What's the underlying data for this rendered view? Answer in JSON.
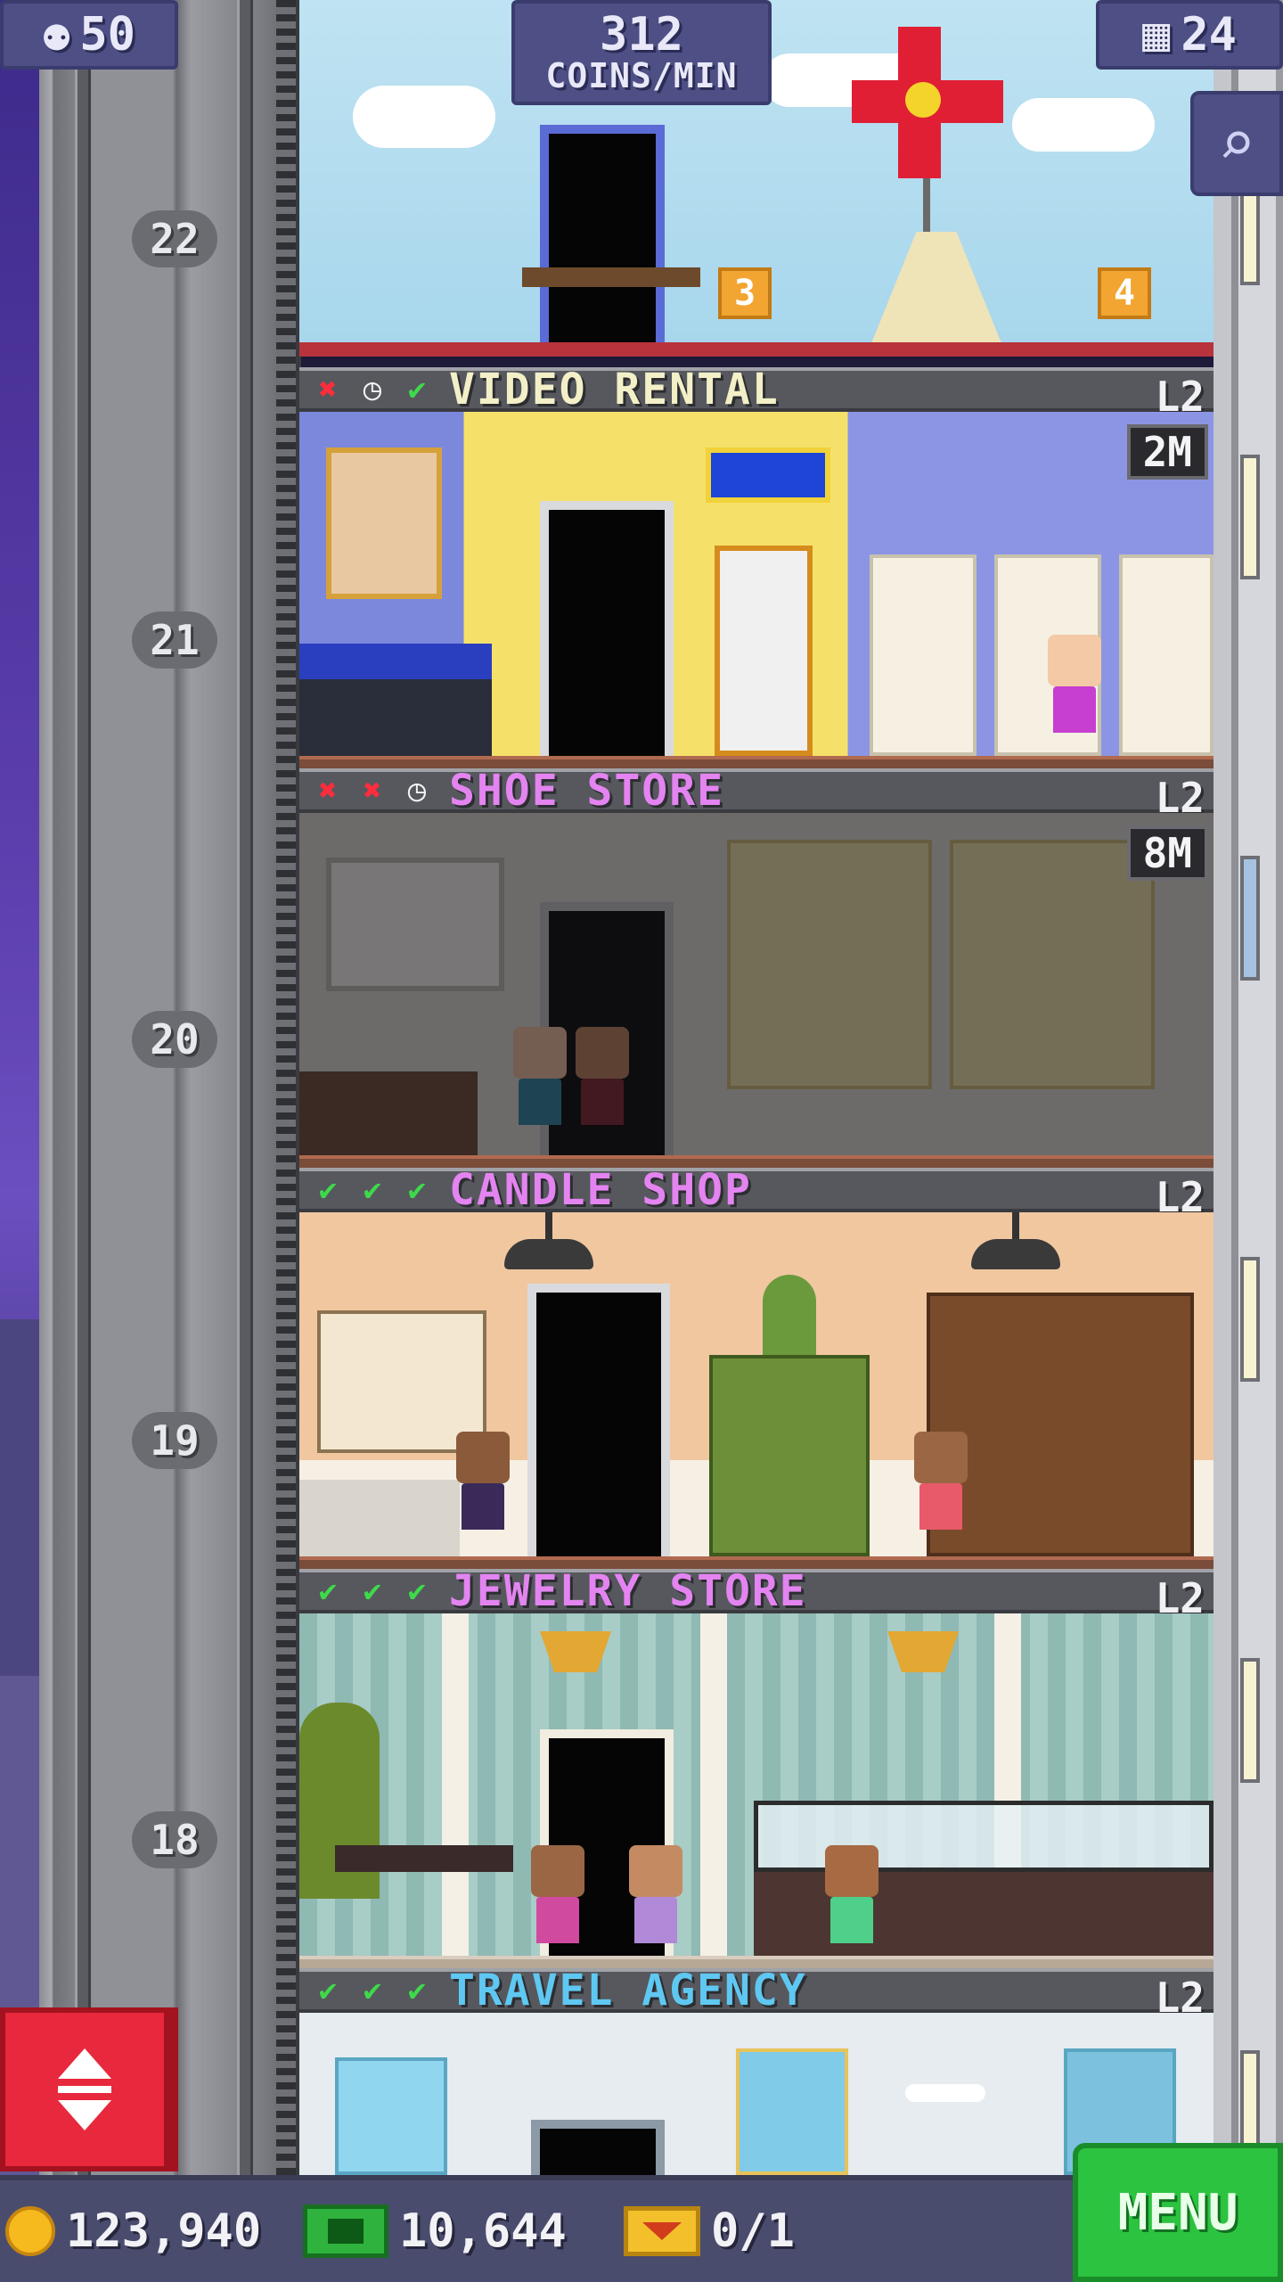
{
  "hud": {
    "population": "50",
    "coins_per_min_value": "312",
    "coins_per_min_label": "COINS/MIN",
    "floor_count": "24"
  },
  "floor_numbers": [
    "22",
    "21",
    "20",
    "19",
    "18"
  ],
  "floors": [
    {
      "name": "VIDEO RENTAL",
      "level": "L2",
      "timer": "2M",
      "stats": [
        "bad",
        "wait",
        "ok"
      ],
      "name_color": "#f3f0c8"
    },
    {
      "name": "SHOE STORE",
      "level": "L2",
      "timer": "8M",
      "stats": [
        "bad",
        "bad",
        "wait"
      ],
      "name_color": "#e384f0"
    },
    {
      "name": "CANDLE SHOP",
      "level": "L2",
      "stats": [
        "ok",
        "ok",
        "ok"
      ],
      "name_color": "#e384f0"
    },
    {
      "name": "JEWELRY STORE",
      "level": "L2",
      "stats": [
        "ok",
        "ok",
        "ok"
      ],
      "name_color": "#e384f0"
    },
    {
      "name": "TRAVEL AGENCY",
      "level": "L2",
      "stats": [
        "ok",
        "ok",
        "ok"
      ],
      "name_color": "#5fc8f2"
    }
  ],
  "lobby_signs": [
    "3",
    "4"
  ],
  "bottom": {
    "coins": "123,940",
    "bux": "10,644",
    "tickets": "0/1",
    "menu_label": "MENU"
  },
  "icons": {
    "population": "person-icon",
    "floors": "building-icon",
    "zoom": "magnifier-icon",
    "elevator": "up-down-arrows-icon",
    "stat_ok": "check-icon",
    "stat_bad": "x-icon",
    "stat_wait": "clock-icon"
  },
  "colors": {
    "hud": "#4d4f85",
    "menu": "#2bc33f",
    "elevator_button": "#e8283c",
    "stat_ok": "#3ed94a",
    "stat_bad": "#ff2c3c"
  }
}
